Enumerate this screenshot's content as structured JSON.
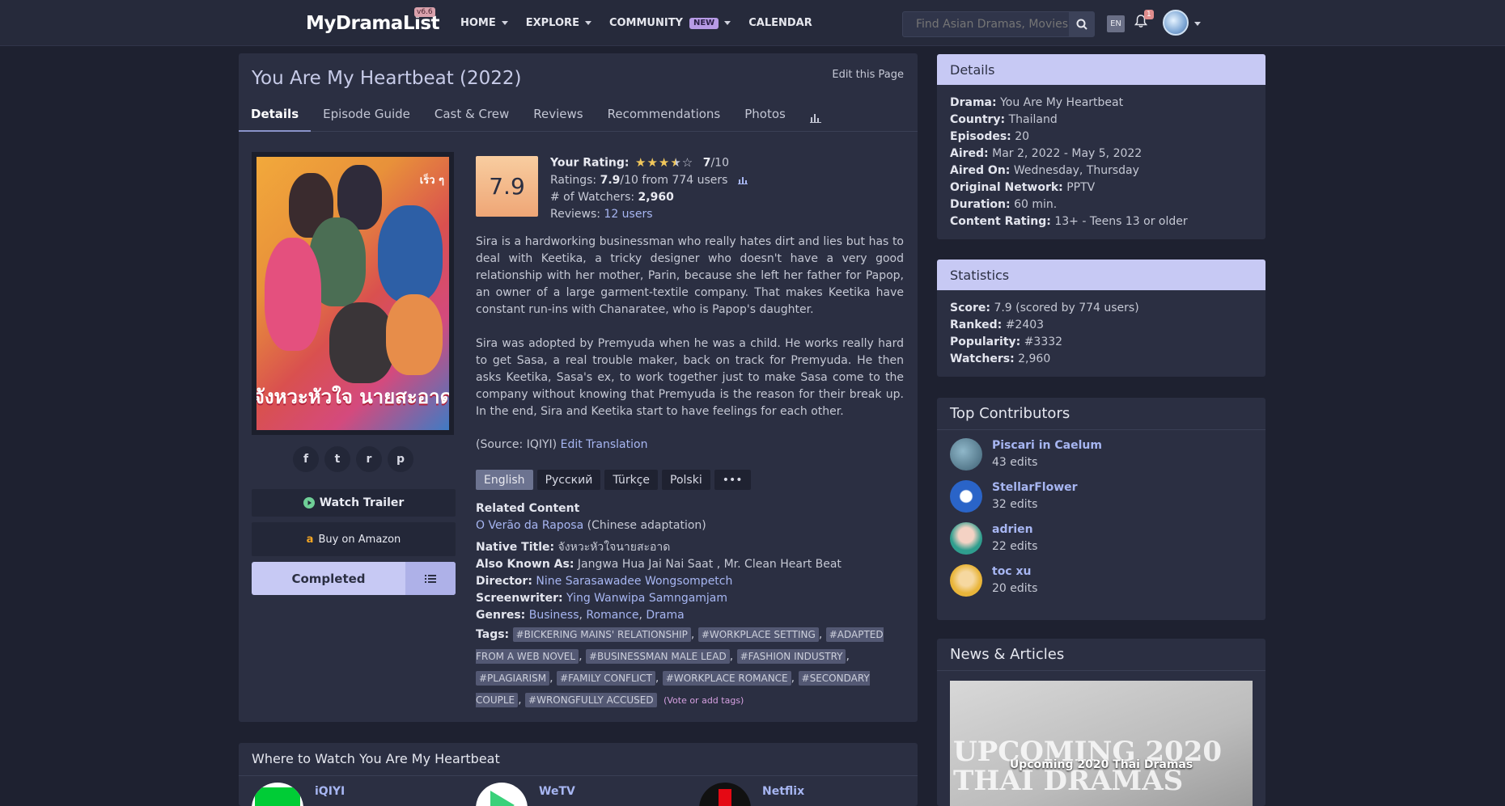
{
  "nav": {
    "logo": "MyDramaList",
    "version": "v6.6",
    "links": [
      {
        "label": "HOME",
        "caret": true
      },
      {
        "label": "EXPLORE",
        "caret": true
      },
      {
        "label": "COMMUNITY",
        "badge": "NEW",
        "caret": true
      },
      {
        "label": "CALENDAR",
        "caret": false
      }
    ],
    "search_placeholder": "Find Asian Dramas, Movies",
    "lang": "EN",
    "notifications": "1"
  },
  "page": {
    "title": "You Are My Heartbeat (2022)",
    "edit_label": "Edit this Page",
    "tabs": [
      "Details",
      "Episode Guide",
      "Cast & Crew",
      "Reviews",
      "Recommendations",
      "Photos"
    ],
    "active_tab": "Details"
  },
  "poster": {
    "title_art": "จังหวะหัวใจ นายสะอาด",
    "corner_text": "เร็ว ๆ"
  },
  "actions": {
    "share": [
      "f",
      "t",
      "r",
      "p"
    ],
    "trailer": "Watch Trailer",
    "amazon": "Buy on Amazon",
    "status": "Completed"
  },
  "rating": {
    "score": "7.9",
    "your_rating_label": "Your Rating:",
    "your_rating_value": "7",
    "your_rating_max": "/10",
    "stars": 3.5,
    "ratings_label": "Ratings:",
    "ratings_value": "7.9",
    "ratings_suffix": "/10 from 774 users",
    "watchers_label": "# of Watchers:",
    "watchers_value": "2,960",
    "reviews_label": "Reviews:",
    "reviews_value": "12 users"
  },
  "synopsis": [
    "Sira is a hardworking businessman who really hates dirt and lies but has to deal with Keetika, a tricky designer who doesn't have a very good relationship with her mother, Parin, because she left her father for Papop, an owner of a large garment-textile company. That makes Keetika have constant run-ins with Chanaratee, who is Papop's daughter.",
    "Sira was adopted by Premyuda when he was a child. He works really hard to get Sasa, a real trouble maker, back on track for Premyuda. He then asks Keetika, Sasa's ex, to work together just to make Sasa come to the company without knowing that Premyuda is the reason for their break up. In the end, Sira and Keetika start to have feelings for each other."
  ],
  "source": {
    "label": "(Source: IQIYI)",
    "link": "Edit Translation"
  },
  "languages": [
    "English",
    "Русский",
    "Türkçe",
    "Polski",
    "•••"
  ],
  "info": {
    "related_head": "Related Content",
    "related_link": "O Verão da Raposa",
    "related_note": "(Chinese adaptation)",
    "native_label": "Native Title:",
    "native_value": "จังหวะหัวใจนายสะอาด",
    "aka_label": "Also Known As:",
    "aka_value": "Jangwa Hua Jai Nai Saat , Mr. Clean Heart Beat",
    "director_label": "Director:",
    "director_value": "Nine Sarasawadee Wongsompetch",
    "writer_label": "Screenwriter:",
    "writer_value": "Ying Wanwipa Samngamjam",
    "genres_label": "Genres:",
    "genres": [
      "Business",
      "Romance",
      "Drama"
    ],
    "tags_label": "Tags:",
    "tags": [
      "#BICKERING MAINS' RELATIONSHIP",
      "#WORKPLACE SETTING",
      "#ADAPTED FROM A WEB NOVEL",
      "#BUSINESSMAN MALE LEAD",
      "#FASHION INDUSTRY",
      "#PLAGIARISM",
      "#FAMILY CONFLICT",
      "#WORKPLACE ROMANCE",
      "#SECONDARY COUPLE",
      "#WRONGFULLY ACCUSED"
    ],
    "vote_tags": "(Vote or add tags)"
  },
  "side_details": {
    "heading": "Details",
    "rows": [
      {
        "label": "Drama:",
        "value": "You Are My Heartbeat"
      },
      {
        "label": "Country:",
        "value": "Thailand"
      },
      {
        "label": "Episodes:",
        "value": "20"
      },
      {
        "label": "Aired:",
        "value": "Mar 2, 2022 - May 5, 2022"
      },
      {
        "label": "Aired On:",
        "value": "Wednesday, Thursday"
      },
      {
        "label": "Original Network:",
        "value": "PPTV"
      },
      {
        "label": "Duration:",
        "value": "60 min."
      },
      {
        "label": "Content Rating:",
        "value": "13+ - Teens 13 or older"
      }
    ]
  },
  "side_stats": {
    "heading": "Statistics",
    "rows": [
      {
        "label": "Score:",
        "value": "7.9 (scored by 774 users)"
      },
      {
        "label": "Ranked:",
        "value": "#2403"
      },
      {
        "label": "Popularity:",
        "value": "#3332"
      },
      {
        "label": "Watchers:",
        "value": "2,960"
      }
    ]
  },
  "contributors": {
    "heading": "Top Contributors",
    "list": [
      {
        "name": "Piscari in Caelum",
        "edits": "43 edits"
      },
      {
        "name": "StellarFlower",
        "edits": "32 edits"
      },
      {
        "name": "adrien",
        "edits": "22 edits"
      },
      {
        "name": "toc xu",
        "edits": "20 edits"
      }
    ]
  },
  "news": {
    "heading": "News & Articles",
    "bg_text": "UPCOMING 2020 THAI DRAMAS",
    "caption": "Upcoming 2020 Thai Dramas"
  },
  "watch": {
    "heading": "Where to Watch You Are My Heartbeat",
    "providers": [
      "iQIYI",
      "WeTV",
      "Netflix"
    ]
  }
}
